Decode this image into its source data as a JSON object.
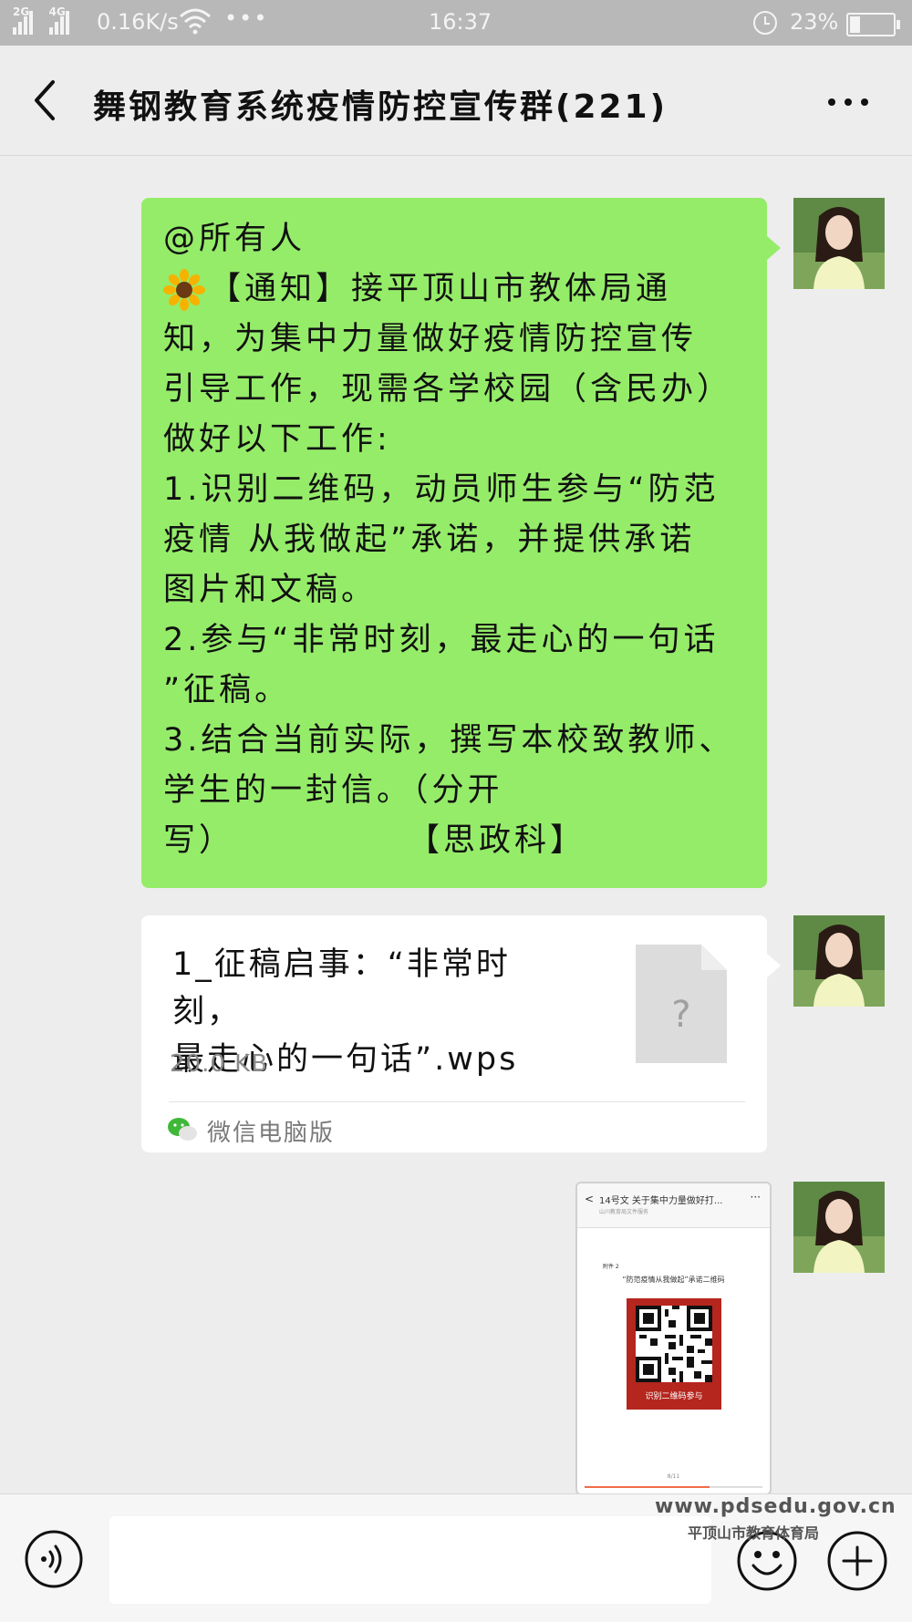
{
  "status_bar": {
    "sig1_label": "2G",
    "sig2_label": "4G",
    "net_speed": "0.16K/s",
    "more_dots": "•••",
    "time": "16:37",
    "battery_text": "23%",
    "battery_level": 0.23,
    "icons": [
      "signal-icon",
      "wifi-icon",
      "alarm-icon",
      "battery-icon"
    ]
  },
  "header": {
    "title": "舞钢教育系统疫情防控宣传群(221)",
    "icons": [
      "back-arrow-icon",
      "more-icon"
    ]
  },
  "messages": {
    "text_message": {
      "lines": [
        "@所有人",
        "【通知】接平顶山市教体局通",
        "知，为集中力量做好疫情防控宣传",
        "引导工作，现需各学校园（含民办）",
        "做好以下工作:",
        "1.识别二维码，动员师生参与“防范",
        "疫情 从我做起”承诺，并提供承诺",
        "图片和文稿。",
        "2.参与“非常时刻，最走心的一句话",
        "”征稿。",
        "3.结合当前实际，撰写本校致教师、",
        "学生的一封信。（分开",
        "写）"
      ],
      "tag": "【思政科】",
      "emoji_icon": "sunflower-icon",
      "bubble_color": "#95ec69"
    },
    "file_message": {
      "name_line1": "1_征稿启事：“非常时刻，",
      "name_line2": "最走心的一句话”.wps",
      "size": "20.0 KB",
      "source": "微信电脑版",
      "placeholder_glyph": "?",
      "icons": [
        "unknown-file-icon",
        "wechat-icon"
      ]
    },
    "image_message": {
      "header_back": "<",
      "header_title": "14号文 关于集中力量做好打...",
      "header_subtitle": "山川教育局文件服务",
      "header_more": "···",
      "small_label": "附件 2",
      "caption": "“防范疫情从我做起”承诺二维码",
      "qr_label": "识别二维码参与",
      "page_indicator": "8/11",
      "progress": 0.7
    }
  },
  "input_bar": {
    "placeholder": "",
    "icons": [
      "voice-icon",
      "emoji-icon",
      "plus-icon"
    ]
  },
  "watermark": {
    "url": "www.pdsedu.gov.cn",
    "org": "平顶山市教育体育局"
  }
}
